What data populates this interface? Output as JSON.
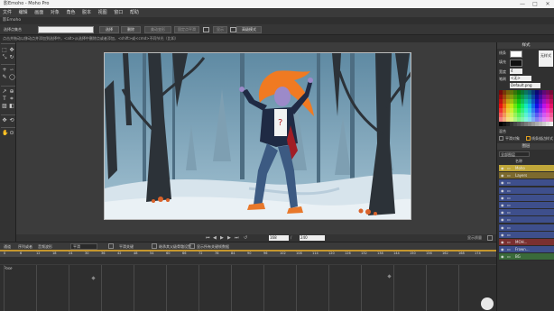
{
  "window": {
    "title": "影Emoho - Moho Pro",
    "buttons": {
      "minimize": "—",
      "maximize": "□",
      "close": "✕"
    }
  },
  "menubar": [
    "文件",
    "编辑",
    "画面",
    "对象",
    "角色",
    "脱本",
    "视图",
    "窗口",
    "帮助"
  ],
  "doc_tab": "影Emoho",
  "tool_options": {
    "field_label": "选择点集合",
    "btn_select": "选择",
    "btn_delete": "删除",
    "btn_weld": "美动变形",
    "btn_label": "固定点平滑",
    "btn_show": "显示",
    "btn_mode": "高级模式"
  },
  "hint": "点击并拖动以移动点并添加到选择中，<alt>从选择中删除点或者添加，<shift>或<cmd>不同节光（比如）",
  "canvas_controls": {
    "frame": "168",
    "of_label": "/",
    "total": "240",
    "label_display": "显示质量"
  },
  "timeline": {
    "tabs": [
      "通道",
      "序列或者",
      "音频波形"
    ],
    "mode": "平滑",
    "opt1": "平滑关键",
    "opt2": "继承其父级骨骼设置",
    "opt3": "显示所有关键帧数据",
    "track_label": "Pose",
    "ticks": [
      "0",
      "6",
      "12",
      "18",
      "24",
      "30",
      "36",
      "42",
      "48",
      "54",
      "60",
      "66",
      "72",
      "78",
      "84",
      "90",
      "96",
      "102",
      "108",
      "114",
      "120",
      "126",
      "132",
      "138",
      "144",
      "150",
      "156",
      "162",
      "168",
      "174"
    ]
  },
  "style_panel": {
    "title": "样式",
    "stroke_label": "线条",
    "fill_label": "填充",
    "width_label": "宽度",
    "width_value": "4",
    "none_label": "无样式",
    "brush_label": "笔刷",
    "brush_value": "<无>",
    "image_value": "Default.png",
    "blend_label": "混合",
    "cb1": "平滑对象",
    "cb2": "线条描边样式"
  },
  "layers_panel": {
    "title": "图层",
    "filter": "全部图层",
    "header": "名称",
    "items": [
      {
        "name": "Moho",
        "color": "#c0a73a"
      },
      {
        "name": "Layers",
        "color": "#7c6a2e"
      },
      {
        "name": "",
        "color": "#3e4f8c"
      },
      {
        "name": "",
        "color": "#3e4f8c"
      },
      {
        "name": "",
        "color": "#3e4f8c"
      },
      {
        "name": "",
        "color": "#3e4f8c"
      },
      {
        "name": "",
        "color": "#3e4f8c"
      },
      {
        "name": "",
        "color": "#3e4f8c"
      },
      {
        "name": "",
        "color": "#3e4f8c"
      },
      {
        "name": "",
        "color": "#3e4f8c"
      },
      {
        "name": "MOH...",
        "color": "#7a3030"
      },
      {
        "name": "Frown...",
        "color": "#3e4f8c"
      },
      {
        "name": "BG",
        "color": "#3a6a3a"
      }
    ]
  },
  "colors": {
    "accent": "#e0a020",
    "palette_bg": "#1e1e1e"
  }
}
